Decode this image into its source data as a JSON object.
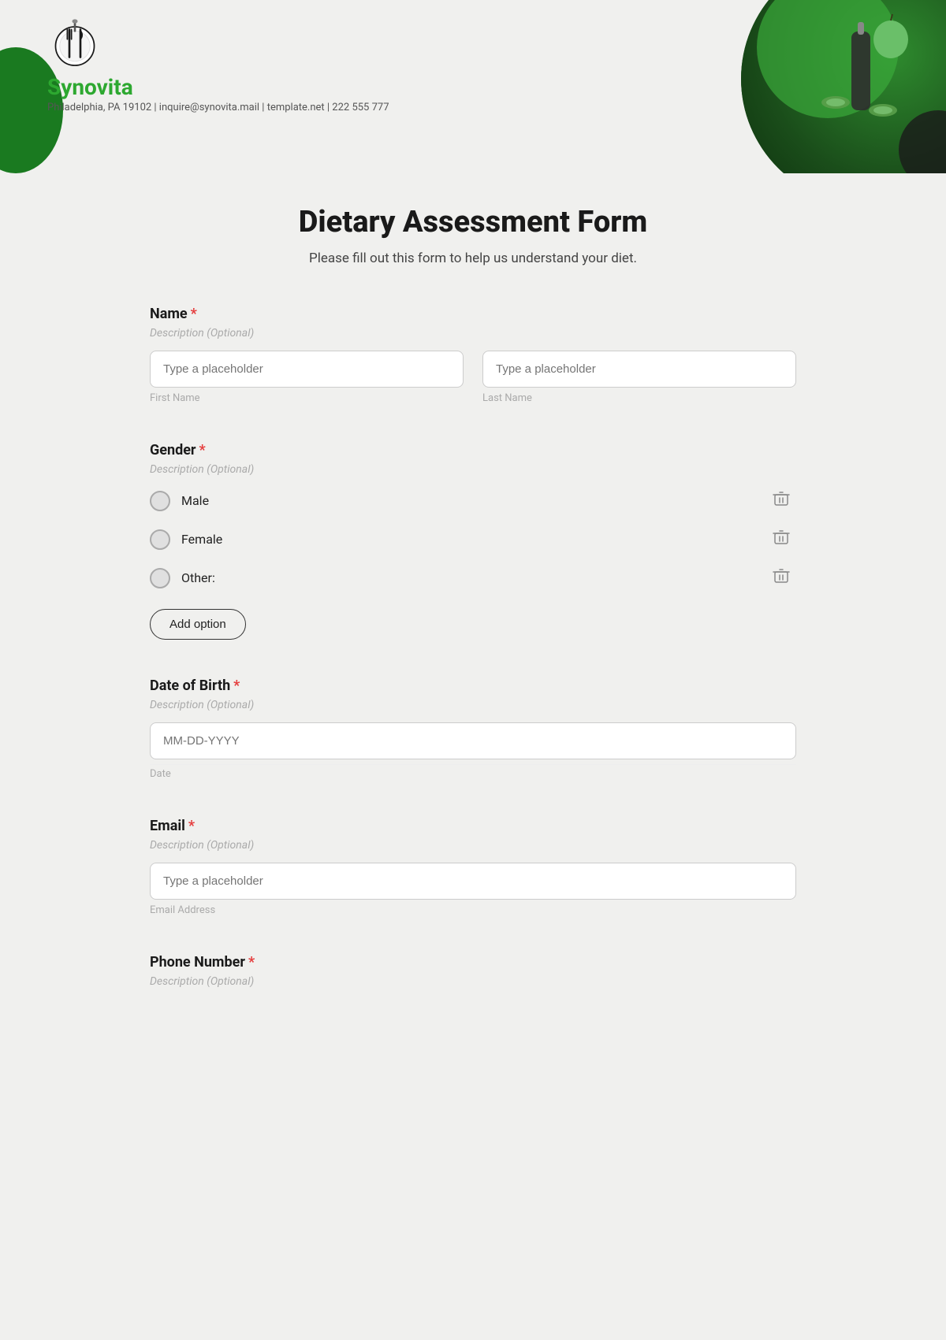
{
  "header": {
    "logo_name": "Synovita",
    "address": "Philadelphia, PA 19102 | inquire@synovita.mail | template.net | 222 555 777"
  },
  "form": {
    "title": "Dietary Assessment Form",
    "subtitle": "Please fill out this form to help us understand your diet.",
    "sections": [
      {
        "id": "name",
        "label": "Name",
        "required": true,
        "description": "Description (Optional)",
        "fields": [
          {
            "placeholder": "Type a placeholder",
            "sublabel": "First Name"
          },
          {
            "placeholder": "Type a placeholder",
            "sublabel": "Last Name"
          }
        ]
      },
      {
        "id": "gender",
        "label": "Gender",
        "required": true,
        "description": "Description (Optional)",
        "options": [
          {
            "label": "Male"
          },
          {
            "label": "Female"
          },
          {
            "label": "Other:"
          }
        ],
        "add_option_label": "Add option"
      },
      {
        "id": "dob",
        "label": "Date of Birth",
        "required": true,
        "description": "Description (Optional)",
        "placeholder": "MM-DD-YYYY",
        "sublabel": "Date"
      },
      {
        "id": "email",
        "label": "Email",
        "required": true,
        "description": "Description (Optional)",
        "placeholder": "Type a placeholder",
        "sublabel": "Email Address"
      },
      {
        "id": "phone",
        "label": "Phone Number",
        "required": true,
        "description": "Description (Optional)"
      }
    ]
  }
}
